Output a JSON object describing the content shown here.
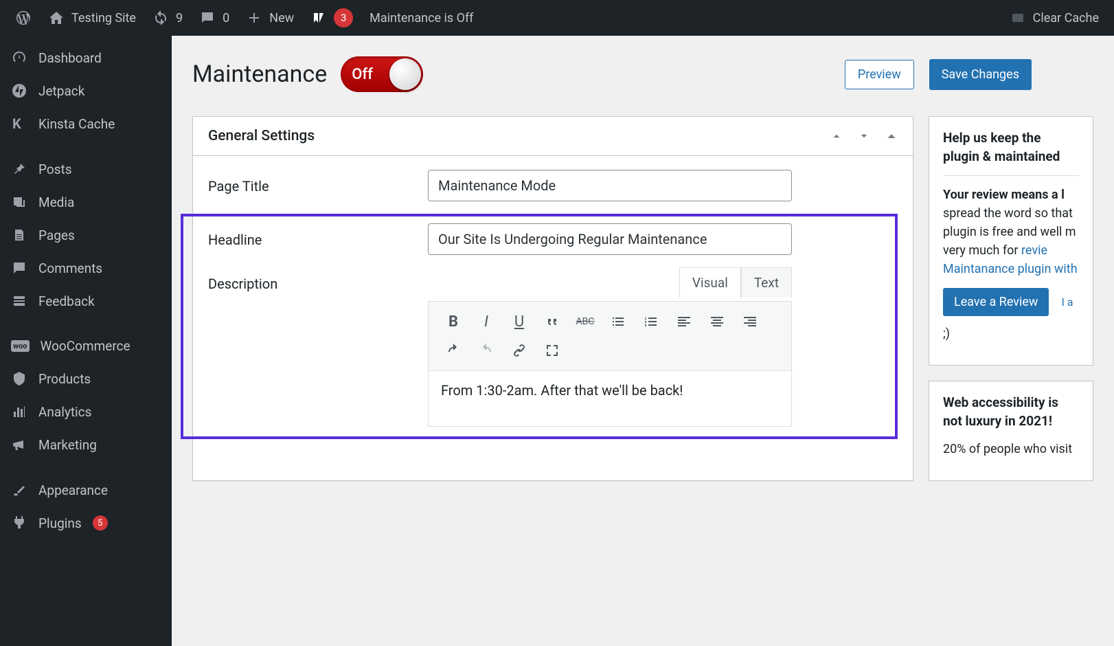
{
  "adminbar": {
    "site_name": "Testing Site",
    "updates_count": "9",
    "comments_count": "0",
    "new_label": "New",
    "yoast_count": "3",
    "maintenance_status": "Maintenance is Off",
    "clear_cache": "Clear Cache"
  },
  "sidebar": {
    "items": [
      {
        "label": "Dashboard"
      },
      {
        "label": "Jetpack"
      },
      {
        "label": "Kinsta Cache"
      },
      {
        "label": "Posts"
      },
      {
        "label": "Media"
      },
      {
        "label": "Pages"
      },
      {
        "label": "Comments"
      },
      {
        "label": "Feedback"
      },
      {
        "label": "WooCommerce"
      },
      {
        "label": "Products"
      },
      {
        "label": "Analytics"
      },
      {
        "label": "Marketing"
      },
      {
        "label": "Appearance"
      },
      {
        "label": "Plugins"
      }
    ]
  },
  "header": {
    "title": "Maintenance",
    "toggle_state": "Off",
    "preview_label": "Preview",
    "save_label": "Save Changes"
  },
  "settings": {
    "panel_title": "General Settings",
    "page_title_label": "Page Title",
    "page_title_value": "Maintenance Mode",
    "headline_label": "Headline",
    "headline_value": "Our Site Is Undergoing Regular Maintenance",
    "description_label": "Description",
    "description_value": "From 1:30-2am. After that we'll be back!",
    "tab_visual": "Visual",
    "tab_text": "Text"
  },
  "side": {
    "panel1_title": "Help us keep the plugin & maintained",
    "panel1_strong": "Your review means a l",
    "panel1_text1": "spread the word so that plugin is free and well m very much for ",
    "panel1_link1": "revie",
    "panel1_link2": "Maintanance plugin with",
    "panel1_button": "Leave a Review",
    "panel1_after": "I a",
    "panel1_wink": ";)",
    "panel2_title": "Web accessibility is not luxury in 2021!",
    "panel2_text": "20% of people who visit"
  }
}
